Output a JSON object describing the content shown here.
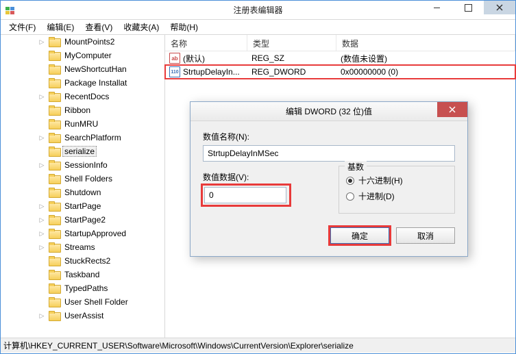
{
  "window": {
    "title": "注册表编辑器"
  },
  "menu": {
    "file": "文件(F)",
    "edit": "编辑(E)",
    "view": "查看(V)",
    "fav": "收藏夹(A)",
    "help": "帮助(H)"
  },
  "tree": {
    "items": [
      {
        "label": "MountPoints2",
        "arrow": "collapsed",
        "indent": 0,
        "selected": false
      },
      {
        "label": "MyComputer",
        "arrow": "none",
        "indent": 0,
        "selected": false
      },
      {
        "label": "NewShortcutHan",
        "arrow": "none",
        "indent": 0,
        "selected": false
      },
      {
        "label": "Package Installat",
        "arrow": "none",
        "indent": 0,
        "selected": false
      },
      {
        "label": "RecentDocs",
        "arrow": "collapsed",
        "indent": 0,
        "selected": false
      },
      {
        "label": "Ribbon",
        "arrow": "none",
        "indent": 0,
        "selected": false
      },
      {
        "label": "RunMRU",
        "arrow": "none",
        "indent": 0,
        "selected": false
      },
      {
        "label": "SearchPlatform",
        "arrow": "collapsed",
        "indent": 0,
        "selected": false
      },
      {
        "label": "serialize",
        "arrow": "none",
        "indent": 0,
        "selected": true
      },
      {
        "label": "SessionInfo",
        "arrow": "collapsed",
        "indent": 0,
        "selected": false
      },
      {
        "label": "Shell Folders",
        "arrow": "none",
        "indent": 0,
        "selected": false
      },
      {
        "label": "Shutdown",
        "arrow": "none",
        "indent": 0,
        "selected": false
      },
      {
        "label": "StartPage",
        "arrow": "collapsed",
        "indent": 0,
        "selected": false
      },
      {
        "label": "StartPage2",
        "arrow": "collapsed",
        "indent": 0,
        "selected": false
      },
      {
        "label": "StartupApproved",
        "arrow": "collapsed",
        "indent": 0,
        "selected": false
      },
      {
        "label": "Streams",
        "arrow": "collapsed",
        "indent": 0,
        "selected": false
      },
      {
        "label": "StuckRects2",
        "arrow": "none",
        "indent": 0,
        "selected": false
      },
      {
        "label": "Taskband",
        "arrow": "none",
        "indent": 0,
        "selected": false
      },
      {
        "label": "TypedPaths",
        "arrow": "none",
        "indent": 0,
        "selected": false
      },
      {
        "label": "User Shell Folder",
        "arrow": "none",
        "indent": 0,
        "selected": false
      },
      {
        "label": "UserAssist",
        "arrow": "collapsed",
        "indent": 0,
        "selected": false
      }
    ]
  },
  "list": {
    "cols": {
      "name": "名称",
      "type": "类型",
      "data": "数据"
    },
    "rows": [
      {
        "icon": "str",
        "icon_text": "ab",
        "name": "(默认)",
        "type": "REG_SZ",
        "data": "(数值未设置)",
        "hl": false
      },
      {
        "icon": "bin",
        "icon_text": "110",
        "name": "StrtupDelayIn...",
        "type": "REG_DWORD",
        "data": "0x00000000 (0)",
        "hl": true
      }
    ]
  },
  "dialog": {
    "title": "编辑 DWORD (32 位)值",
    "name_label": "数值名称(N):",
    "name_value": "StrtupDelayInMSec",
    "data_label": "数值数据(V):",
    "data_value": "0",
    "base_label": "基数",
    "radio_hex": "十六进制(H)",
    "radio_dec": "十进制(D)",
    "ok": "确定",
    "cancel": "取消"
  },
  "status": {
    "path": "计算机\\HKEY_CURRENT_USER\\Software\\Microsoft\\Windows\\CurrentVersion\\Explorer\\serialize"
  }
}
